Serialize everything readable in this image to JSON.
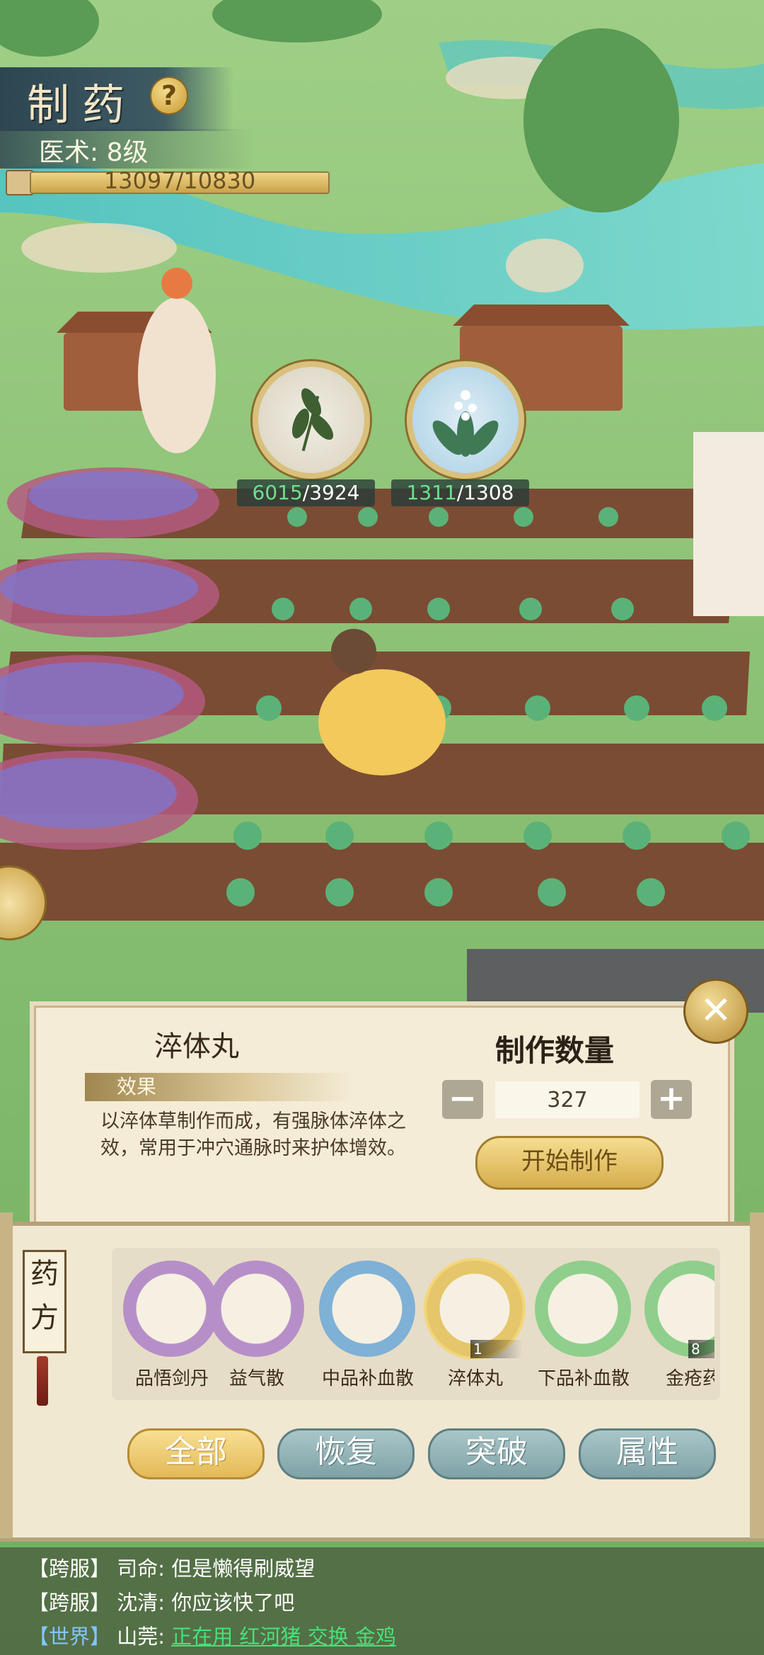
{
  "header": {
    "title": "制药",
    "help_icon": "question-icon",
    "skill_text": "医术: 8级",
    "xp_text": "13097/10830",
    "xp_current": 13097,
    "xp_max": 10830
  },
  "resources": [
    {
      "icon": "herb-leaf-icon",
      "current": "6015",
      "required": "/3924"
    },
    {
      "icon": "white-flower-plant-icon",
      "current": "1311",
      "required": "/1308"
    }
  ],
  "panel": {
    "item_name": "淬体丸",
    "effect_label": "效果",
    "description": "以淬体草制作而成，有强脉体淬体之效，常用于冲穴通脉时来护体增效。",
    "quantity_title": "制作数量",
    "minus_label": "−",
    "plus_label": "+",
    "quantity_value": "327",
    "start_button": "开始制作",
    "close_icon": "close-icon"
  },
  "recipes": {
    "tag": "药方",
    "items": [
      {
        "name": "品悟剑丹",
        "icon": "crystal-orb-icon",
        "ring": "#b78fc8"
      },
      {
        "name": "益气散",
        "icon": "vase-icon",
        "ring": "#b78fc8"
      },
      {
        "name": "中品补血散",
        "icon": "powder-paper-icon",
        "ring": "#7fb0d6"
      },
      {
        "name": "淬体丸",
        "icon": "pill-box-icon",
        "ring": "#e6c66a",
        "count": "1",
        "selected": true
      },
      {
        "name": "下品补血散",
        "icon": "powder-paper-icon",
        "ring": "#8fcf8b"
      },
      {
        "name": "金疮药",
        "icon": "powder-paper-icon",
        "ring": "#8fcf8b",
        "count": "8"
      }
    ],
    "tabs": [
      {
        "label": "全部",
        "active": true
      },
      {
        "label": "恢复",
        "active": false
      },
      {
        "label": "突破",
        "active": false
      },
      {
        "label": "属性",
        "active": false
      }
    ]
  },
  "chat": [
    {
      "channel": "【跨服】",
      "sender": "司命:",
      "message": "但是懒得刷威望"
    },
    {
      "channel": "【跨服】",
      "sender": "沈清:",
      "message": "你应该快了吧"
    },
    {
      "channel": "【世界】",
      "sender": "山莞:",
      "message": "正在用 红河猪 交换 金鸡"
    }
  ],
  "side_button_icon": "chat-bubble-icon"
}
